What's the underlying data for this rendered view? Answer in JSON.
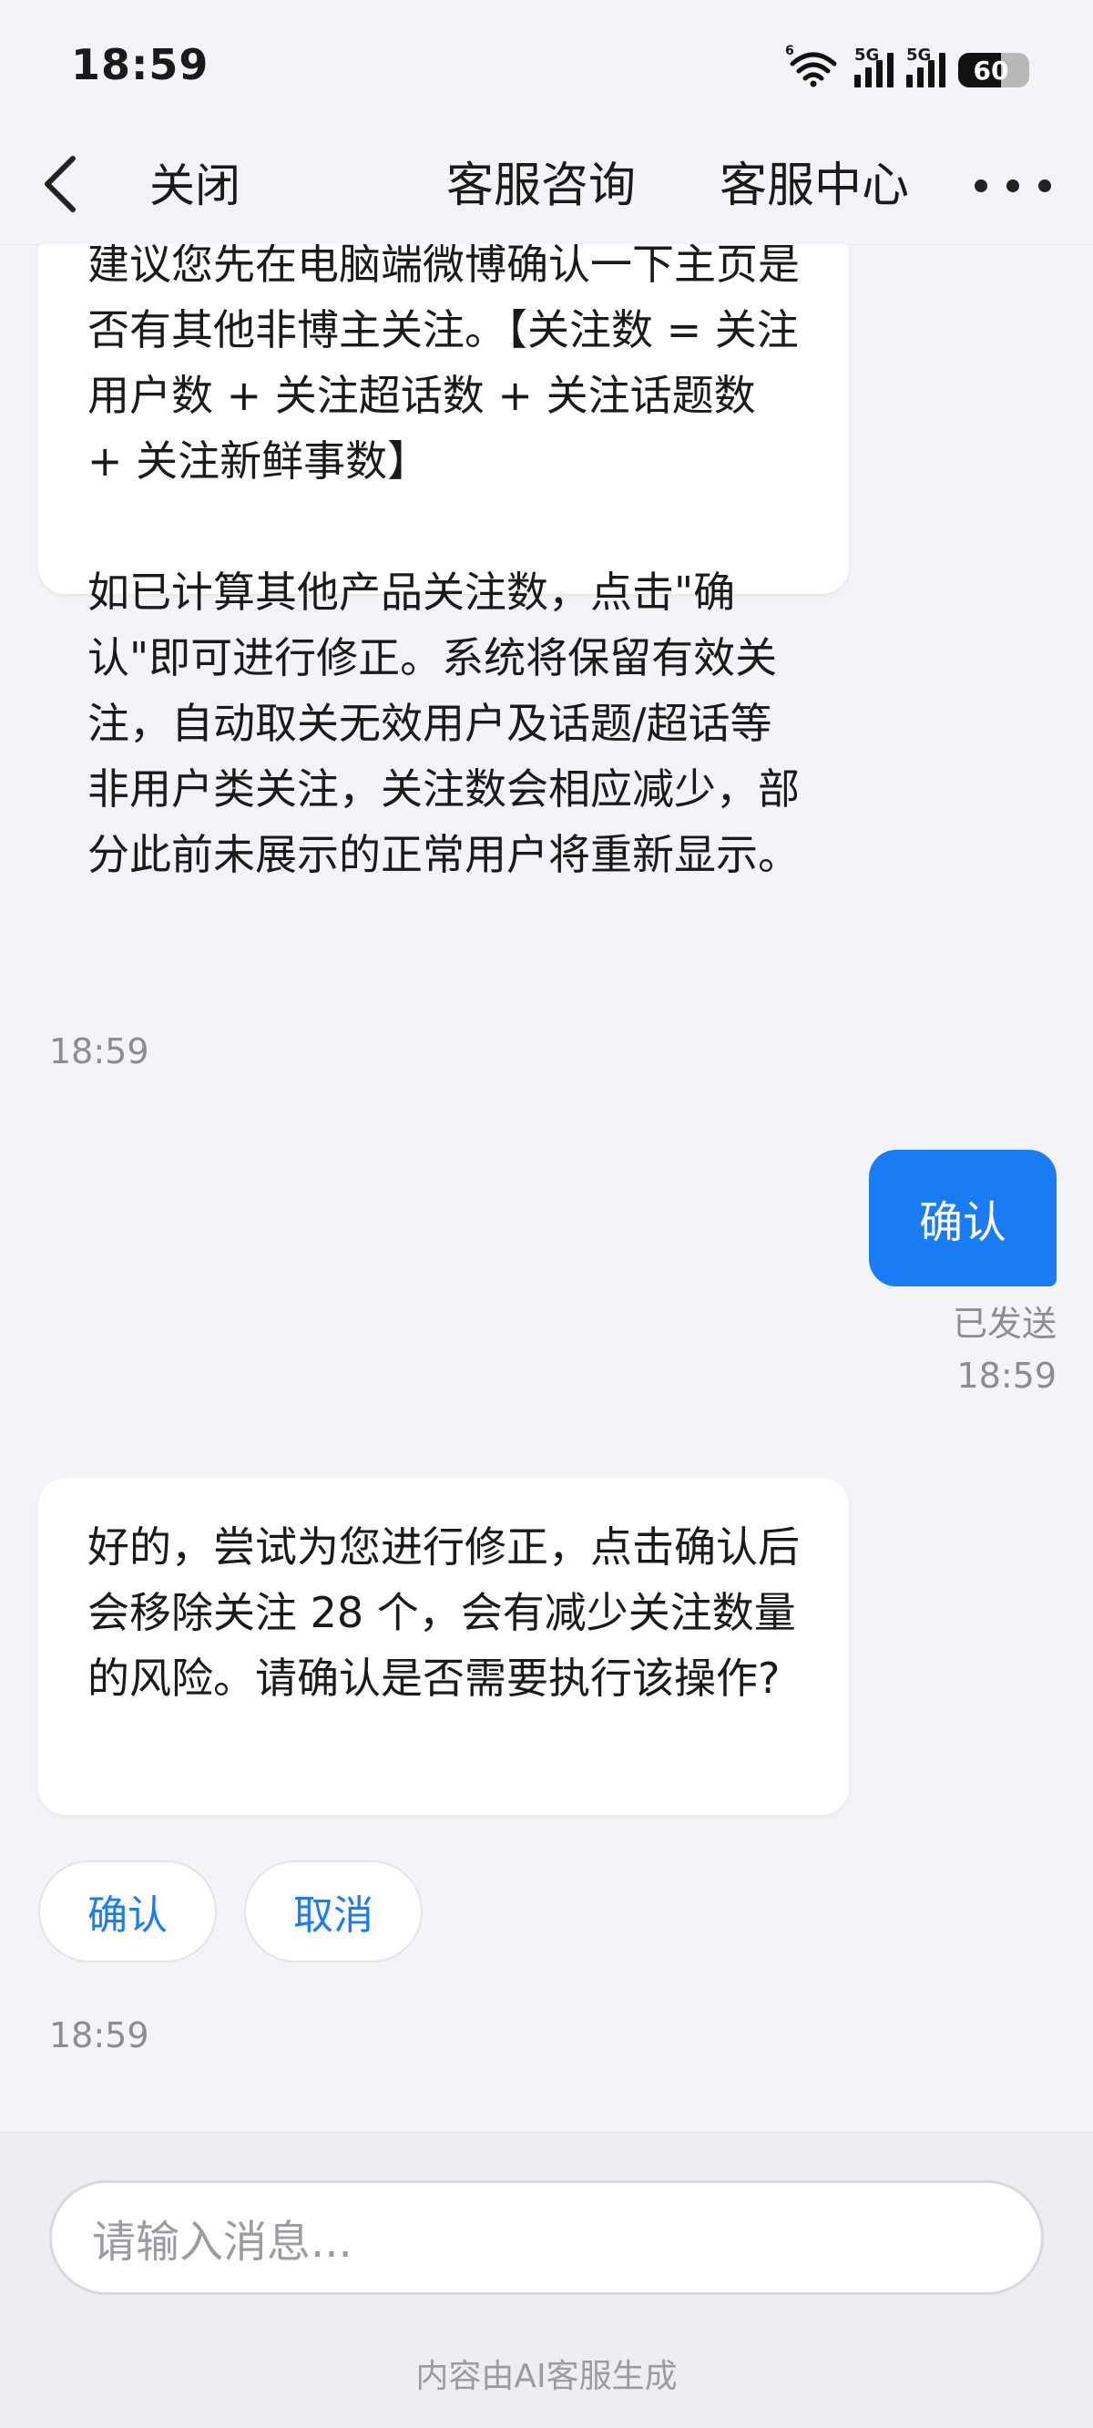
{
  "status_bar": {
    "time": "18:59",
    "wifi_badge": "6",
    "signal1_label": "5G",
    "signal2_label": "5G",
    "battery": "60",
    "battery_level": 0.6
  },
  "nav": {
    "back_icon": "chevron-left-icon",
    "close_label": "关闭",
    "consult_label": "客服咨询",
    "center_label": "客服中心",
    "more_icon": "more-dots-icon"
  },
  "messages": [
    {
      "type": "incoming",
      "paragraph1": "建议您先在电脑端微博确认一下主页是否有其他非博主关注。【关注数 = 关注用户数 + 关注超话数 + 关注话题数 + 关注新鲜事数】",
      "paragraph2": "如已计算其他产品关注数，点击\"确认\"即可进行修正。系统将保留有效关注，自动取关无效用户及话题/超话等非用户类关注，关注数会相应减少，部分此前未展示的正常用户将重新显示。",
      "time": "18:59"
    },
    {
      "type": "outgoing",
      "text": "确认",
      "status": "已发送",
      "time": "18:59"
    },
    {
      "type": "incoming",
      "text": "好的，尝试为您进行修正，点击确认后会移除关注 28 个，会有减少关注数量的风险。请确认是否需要执行该操作?",
      "options": [
        "确认",
        "取消"
      ],
      "time": "18:59"
    }
  ],
  "composer": {
    "placeholder": "请输入消息...",
    "note": "内容由AI客服生成"
  },
  "colors": {
    "accent": "#1a7cf5",
    "background": "#f3f4f7",
    "bubble": "#ffffff"
  }
}
